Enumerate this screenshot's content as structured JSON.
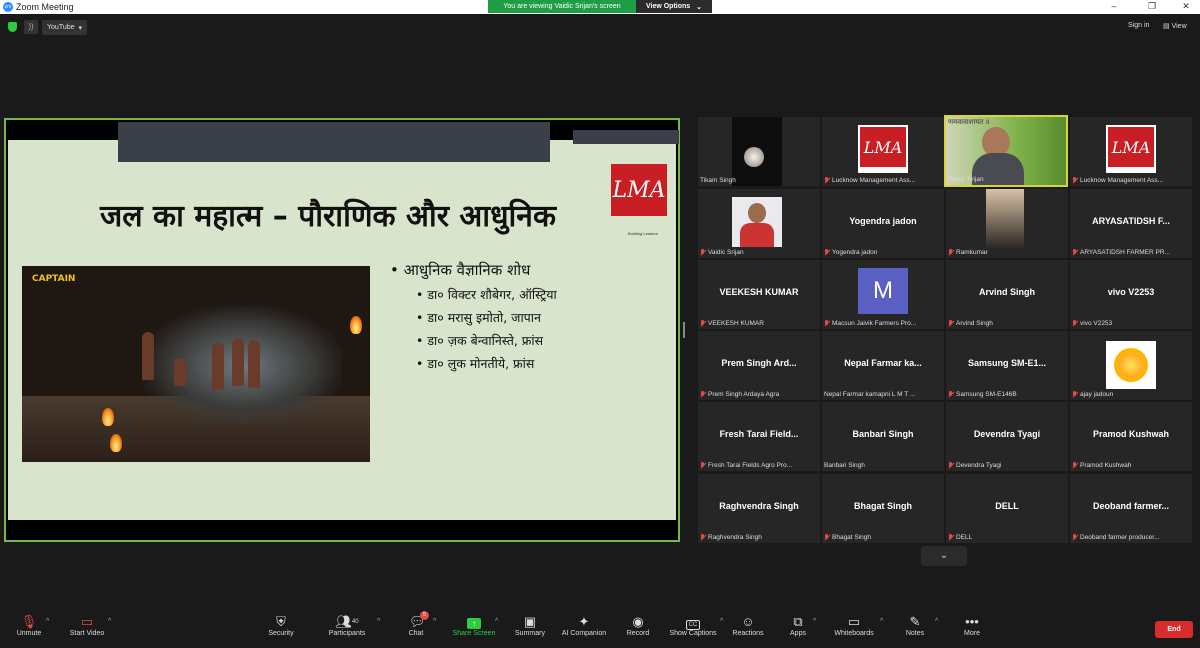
{
  "window": {
    "title": "Zoom Meeting",
    "viewing_banner": "You are viewing Vaidic Srijan's screen",
    "view_options": "View Options",
    "controls": [
      "–",
      "❐",
      "✕"
    ]
  },
  "topbar": {
    "youtube_label": "YouTube",
    "sign_in": "Sign in",
    "view": "View"
  },
  "slide": {
    "title": "जल का महात्म – पौराणिक और आधुनिक",
    "logo_text": "LMA",
    "logo_subtitle": "Building Leaders",
    "video_watermark": "CAPTAIN",
    "main_bullet": "आधुनिक वैज्ञानिक शोध",
    "sub_bullets": [
      "डा० विक्टर शौबेगर, ऑस्ट्रिया",
      "डा० मरासु इमोतो, जापान",
      "डा० ज़क बेन्वानिस्ते, फ्रांस",
      "डा० लुक मोनतीये, फ्रांस"
    ]
  },
  "gallery": {
    "tiles": [
      {
        "display": "",
        "label": "Tikam Singh"
      },
      {
        "display": "",
        "label": "Lucknow Management Ass..."
      },
      {
        "display": "",
        "label": "Vaidic Srijan"
      },
      {
        "display": "",
        "label": "Lucknow Management Ass..."
      },
      {
        "display": "",
        "label": "Vaidic Srijan"
      },
      {
        "display": "Yogendra jadon",
        "label": "Yogendra jadon"
      },
      {
        "display": "",
        "label": "Ramkumar"
      },
      {
        "display": "ARYASATIDSH F...",
        "label": "ARYASATIDSH FARMER PR..."
      },
      {
        "display": "VEEKESH KUMAR",
        "label": "VEEKESH KUMAR"
      },
      {
        "display": "M",
        "label": "Macsun Jaivik Farmers Pro..."
      },
      {
        "display": "Arvind Singh",
        "label": "Arvind Singh"
      },
      {
        "display": "vivo V2253",
        "label": "vivo V2253"
      },
      {
        "display": "Prem Singh Ard...",
        "label": "Prem Singh Ardaya Agra"
      },
      {
        "display": "Nepal Farmar ka...",
        "label": "Nepal Farmar kamapni L M T ..."
      },
      {
        "display": "Samsung SM-E1...",
        "label": "Samsung SM-E146B"
      },
      {
        "display": "",
        "label": "ajay jadoun"
      },
      {
        "display": "Fresh Tarai Field...",
        "label": "Fresh Tarai Fields Agro Pro..."
      },
      {
        "display": "Banbari Singh",
        "label": "Banbari Singh"
      },
      {
        "display": "Devendra Tyagi",
        "label": "Devendra Tyagi"
      },
      {
        "display": "Pramod Kushwah",
        "label": "Pramod Kushwah"
      },
      {
        "display": "Raghvendra Singh",
        "label": "Raghvendra Singh"
      },
      {
        "display": "Bhagat Singh",
        "label": "Bhagat Singh"
      },
      {
        "display": "DELL",
        "label": "DELL"
      },
      {
        "display": "Deoband farmer...",
        "label": "Deoband farmer producer..."
      }
    ],
    "speaker_photo_text": "णमवावाशायत ॥"
  },
  "toolbar": {
    "unmute": "Unmute",
    "start_video": "Start Video",
    "security": "Security",
    "participants": "Participants",
    "participants_count": "40",
    "chat": "Chat",
    "chat_badge": "5",
    "share_screen": "Share Screen",
    "summary": "Summary",
    "ai_companion": "AI Companion",
    "record": "Record",
    "show_captions": "Show Captions",
    "reactions": "Reactions",
    "apps": "Apps",
    "whiteboards": "Whiteboards",
    "notes": "Notes",
    "more": "More",
    "end": "End"
  },
  "colors": {
    "share_banner": "#1f9d45",
    "slide_border": "#77b84a",
    "slide_bg": "#d9e4cc",
    "lma_red": "#c81e24",
    "active_speaker": "#d7d43a",
    "end_button": "#d92d2d"
  }
}
